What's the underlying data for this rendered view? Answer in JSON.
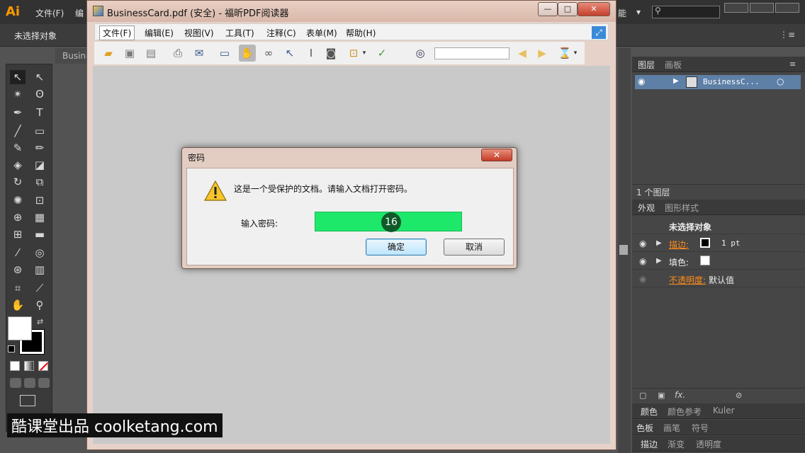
{
  "ai": {
    "menus": [
      "文件(F)",
      "编"
    ],
    "right_menu_fragment": "能",
    "control_bar_text": "未选择对象",
    "doc_tab": "Busine",
    "layers_panel": {
      "tabs": [
        "图层",
        "画板"
      ],
      "layer_name": "BusinessC...",
      "footer": "1 个图层"
    },
    "appearance_panel": {
      "tabs": [
        "外观",
        "图形样式"
      ],
      "header": "未选择对象",
      "stroke_label": "描边:",
      "stroke_value": "1 pt",
      "fill_label": "填色:",
      "opacity_label": "不透明度:",
      "opacity_value": "默认值"
    },
    "bottom_panels": {
      "row1": [
        "颜色",
        "颜色参考",
        "Kuler"
      ],
      "row2": [
        "色板",
        "画笔",
        "符号"
      ],
      "row3": [
        "描边",
        "渐变",
        "透明度"
      ]
    }
  },
  "foxit": {
    "title": "BusinessCard.pdf (安全) - 福昕PDF阅读器",
    "window_buttons": {
      "minimize": "—",
      "maximize": "□",
      "close": "✕"
    },
    "menu": [
      "文件(F)",
      "编辑(E)",
      "视图(V)",
      "工具(T)",
      "注释(C)",
      "表单(M)",
      "帮助(H)"
    ]
  },
  "dialog": {
    "title": "密码",
    "close": "✕",
    "message": "这是一个受保护的文档。请输入文档打开密码。",
    "password_label": "输入密码:",
    "password_value": "",
    "step_badge": "16",
    "ok_label": "确定",
    "cancel_label": "取消"
  },
  "watermark": "酷课堂出品 coolketang.com"
}
